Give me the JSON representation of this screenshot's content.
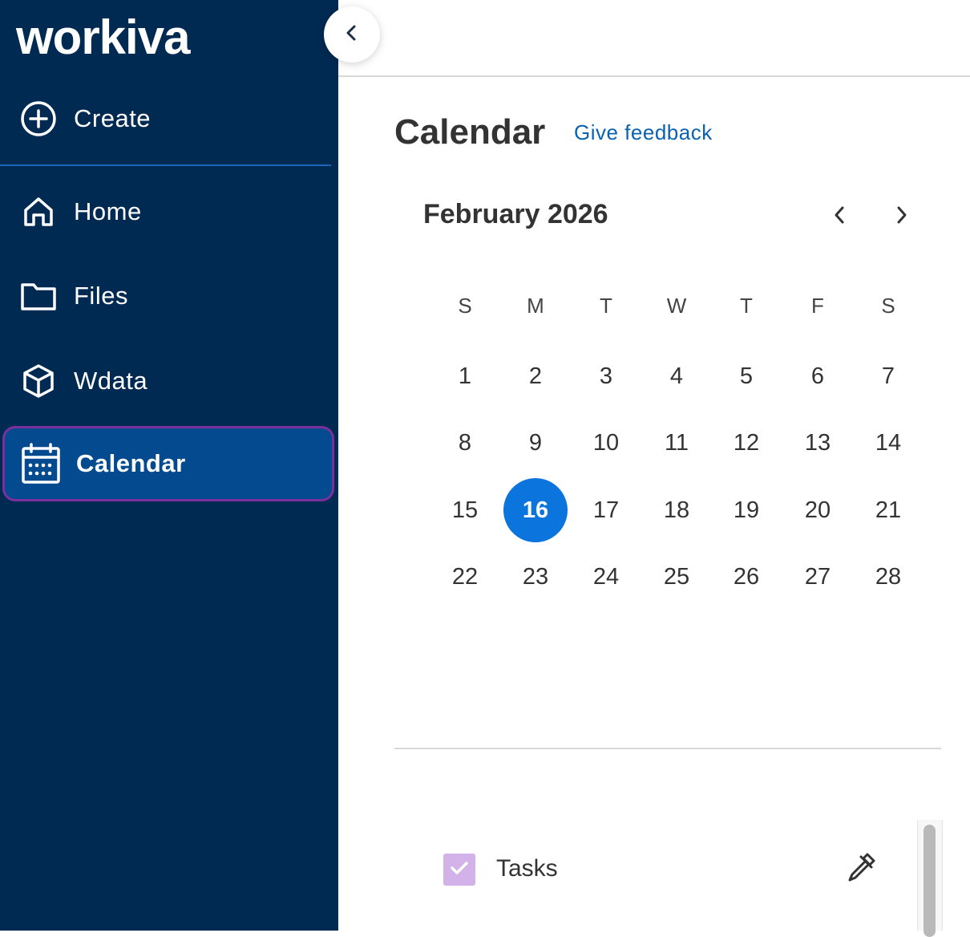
{
  "brand": {
    "logo_text": "workiva"
  },
  "sidebar": {
    "create_label": "Create",
    "items": [
      {
        "label": "Home",
        "icon": "home-icon"
      },
      {
        "label": "Files",
        "icon": "folder-icon"
      },
      {
        "label": "Wdata",
        "icon": "cube-icon"
      },
      {
        "label": "Calendar",
        "icon": "calendar-icon",
        "active": true
      }
    ]
  },
  "header": {
    "title": "Calendar",
    "feedback_link": "Give feedback"
  },
  "calendar": {
    "month_label": "February 2026",
    "weekdays": [
      "S",
      "M",
      "T",
      "W",
      "T",
      "F",
      "S"
    ],
    "weeks": [
      [
        "1",
        "2",
        "3",
        "4",
        "5",
        "6",
        "7"
      ],
      [
        "8",
        "9",
        "10",
        "11",
        "12",
        "13",
        "14"
      ],
      [
        "15",
        "16",
        "17",
        "18",
        "19",
        "20",
        "21"
      ],
      [
        "22",
        "23",
        "24",
        "25",
        "26",
        "27",
        "28"
      ]
    ],
    "selected_day": "16"
  },
  "filters": {
    "tasks_label": "Tasks",
    "tasks_checked": true,
    "tasks_color": "#d3b2ea"
  },
  "colors": {
    "sidebar_bg": "#002a52",
    "active_bg": "#044a8f",
    "active_border": "#7b2f9d",
    "accent": "#0b74dd",
    "link": "#0a62b0"
  }
}
